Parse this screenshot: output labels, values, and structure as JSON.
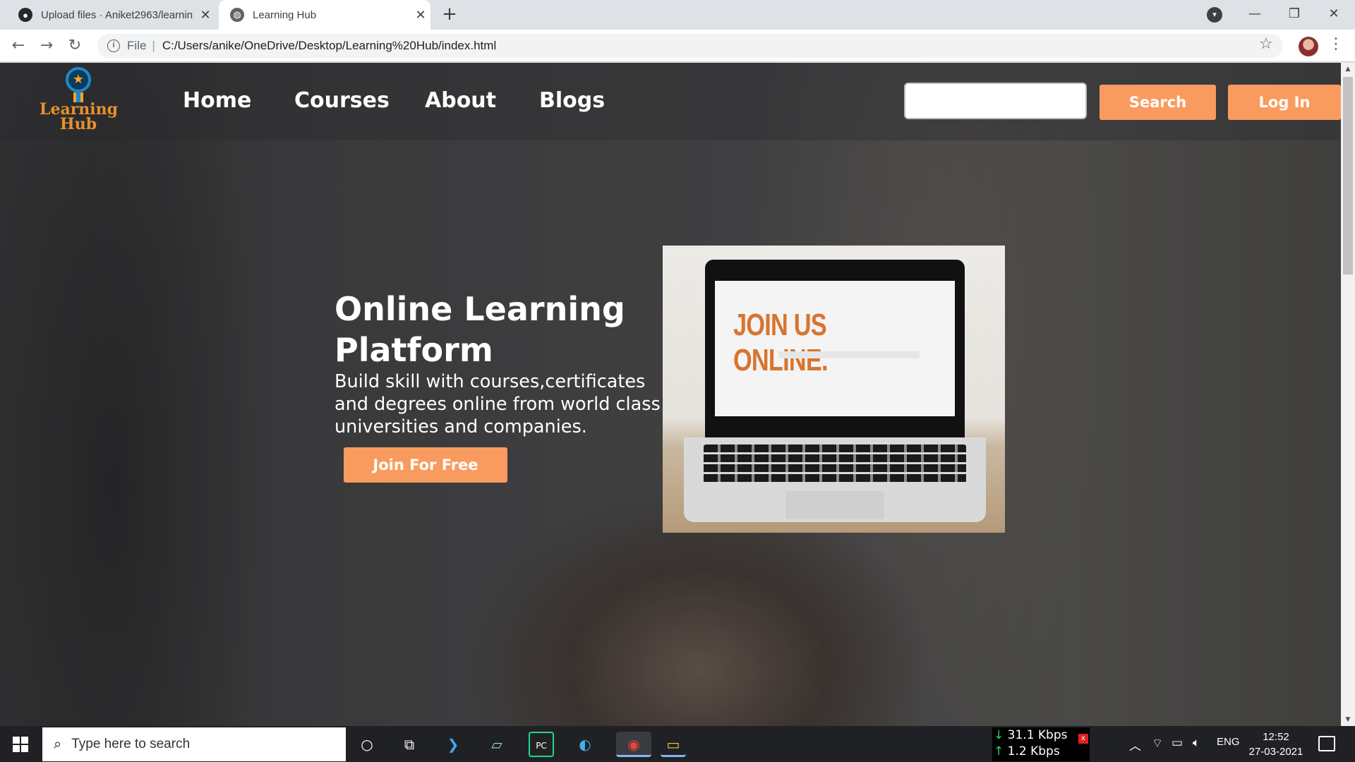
{
  "browser": {
    "tabs": [
      {
        "title": "Upload files · Aniket2963/learnin",
        "active": false
      },
      {
        "title": "Learning Hub",
        "active": true
      }
    ],
    "address": {
      "scheme": "File",
      "path": "C:/Users/anike/OneDrive/Desktop/Learning%20Hub/index.html"
    }
  },
  "site": {
    "logo": {
      "line1": "Learning",
      "line2": "Hub"
    },
    "nav": [
      "Home",
      "Courses",
      "About",
      "Blogs"
    ],
    "search": {
      "value": "",
      "placeholder": "",
      "button": "Search"
    },
    "login_label": "Log In",
    "hero": {
      "title": "Online Learning Platform",
      "subtitle": "Build skill with courses,certificates and degrees online from world class universities and companies.",
      "cta": "Join For Free",
      "image_text": "JOIN US ONLINE."
    },
    "colors": {
      "accent": "#f99b5f",
      "logo": "#e8902c"
    }
  },
  "taskbar": {
    "search_placeholder": "Type here to search",
    "network": {
      "down": "31.1 Kbps",
      "up": "1.2 Kbps"
    },
    "language": "ENG",
    "time": "12:52",
    "date": "27-03-2021"
  }
}
